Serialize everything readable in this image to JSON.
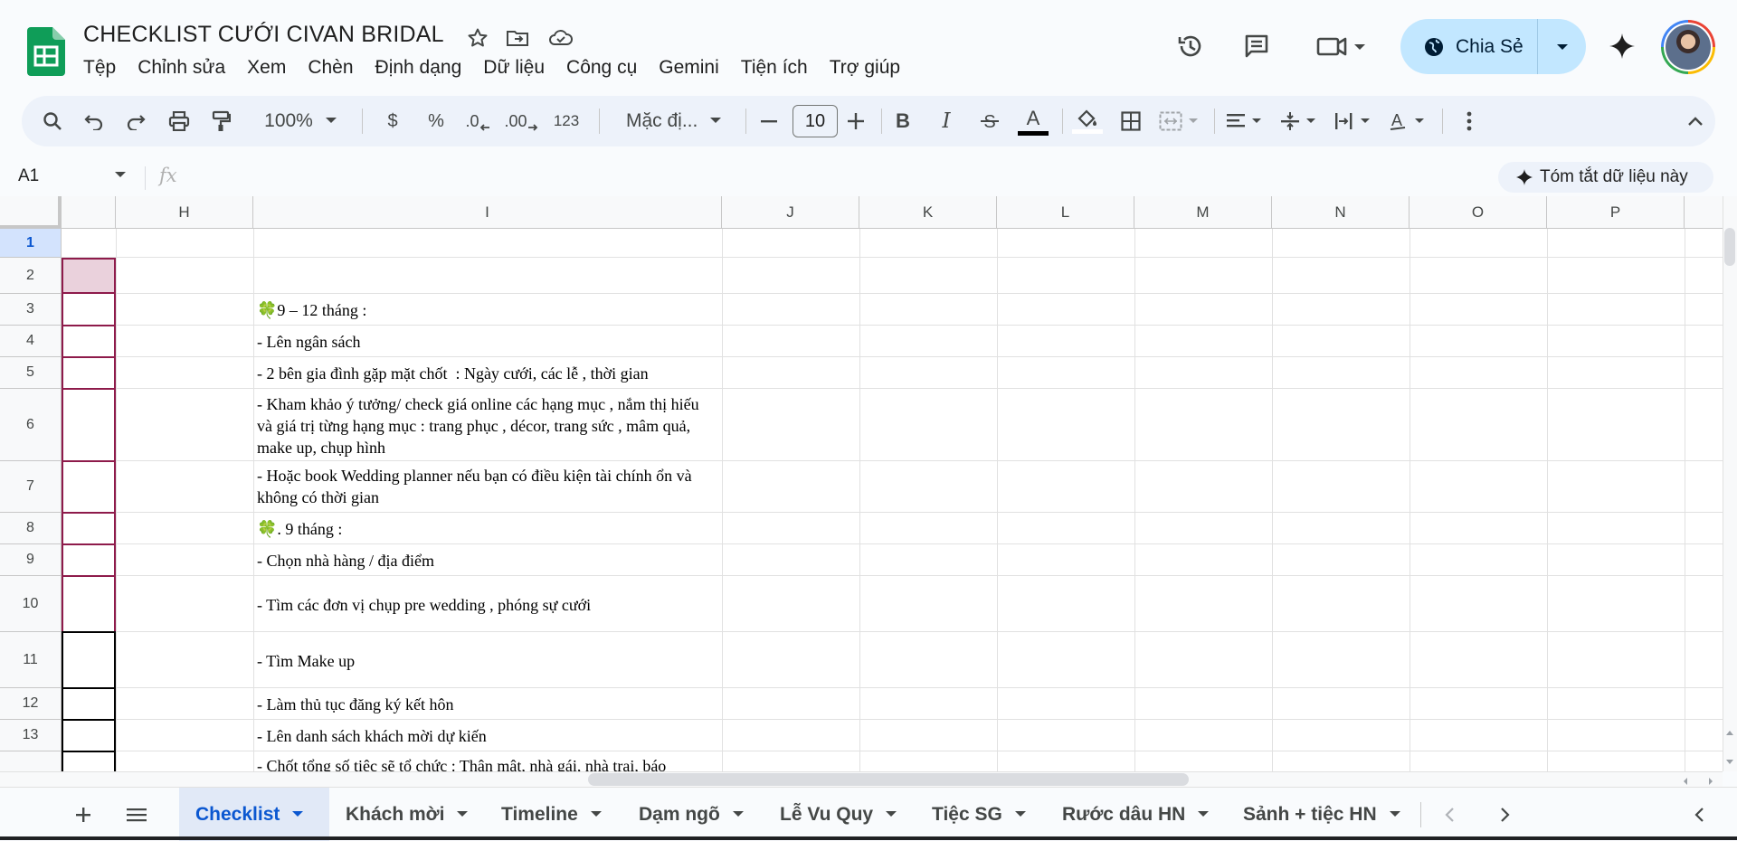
{
  "app": {
    "title": "CHECKLIST CƯỚI CIVAN BRIDAL",
    "menu": [
      "Tệp",
      "Chỉnh sửa",
      "Xem",
      "Chèn",
      "Định dạng",
      "Dữ liệu",
      "Công cụ",
      "Gemini",
      "Tiện ích",
      "Trợ giúp"
    ],
    "share_label": "Chia Sẻ"
  },
  "toolbar": {
    "zoom": "100%",
    "currency": "$",
    "percent": "%",
    "decimal_decrease": ".0",
    "decimal_increase": ".00",
    "number_format": "123",
    "font": "Mặc đị...",
    "font_size": "10",
    "bold": "B",
    "italic": "I",
    "text_color_letter": "A"
  },
  "formula_bar": {
    "cell_ref": "A1",
    "fx": "fx",
    "summarize": "Tóm tắt dữ liệu này"
  },
  "grid": {
    "columns": [
      "H",
      "I",
      "J",
      "K",
      "L",
      "M",
      "N",
      "O",
      "P"
    ],
    "rows": [
      "1",
      "2",
      "3",
      "4",
      "5",
      "6",
      "7",
      "8",
      "9",
      "10",
      "11",
      "12",
      "13"
    ],
    "cells": [
      "",
      "",
      "🍀9 – 12 tháng :",
      "- Lên ngân sách",
      "- 2 bên gia đình gặp mặt chốt  : Ngày cưới, các lễ , thời gian",
      "- Kham khảo ý tưởng/ check giá online các hạng mục , nắm thị hiếu và giá trị từng hạng mục : trang phục , décor, trang sức , mâm quả, make up, chụp hình",
      "- Hoặc book Wedding planner nếu bạn có điều kiện tài chính ổn và không có thời gian",
      "🍀. 9 tháng :",
      "- Chọn nhà hàng / địa điểm",
      "- Tìm các đơn vị chụp pre wedding , phóng sự cưới",
      "- Tìm Make up",
      "- Làm thủ tục đăng ký kết hôn",
      "- Lên danh sách khách mời dự kiến",
      "- Chốt tổng số tiệc sẽ tổ chức : Thân mật, nhà gái, nhà trai, báo"
    ]
  },
  "sheets": {
    "tabs": [
      "Checklist",
      "Khách mời",
      "Timeline",
      "Dạm ngõ",
      "Lễ Vu Quy",
      "Tiệc SG",
      "Rước dâu HN",
      "Sảnh + tiệc HN"
    ],
    "active": "Checklist"
  },
  "colors": {
    "accent": "#0b57d0",
    "share_bg": "#c2e7ff",
    "sheets_green": "#0f9d58",
    "border_maroon": "#8e1b4b",
    "row2_fill": "#ead1dc"
  }
}
